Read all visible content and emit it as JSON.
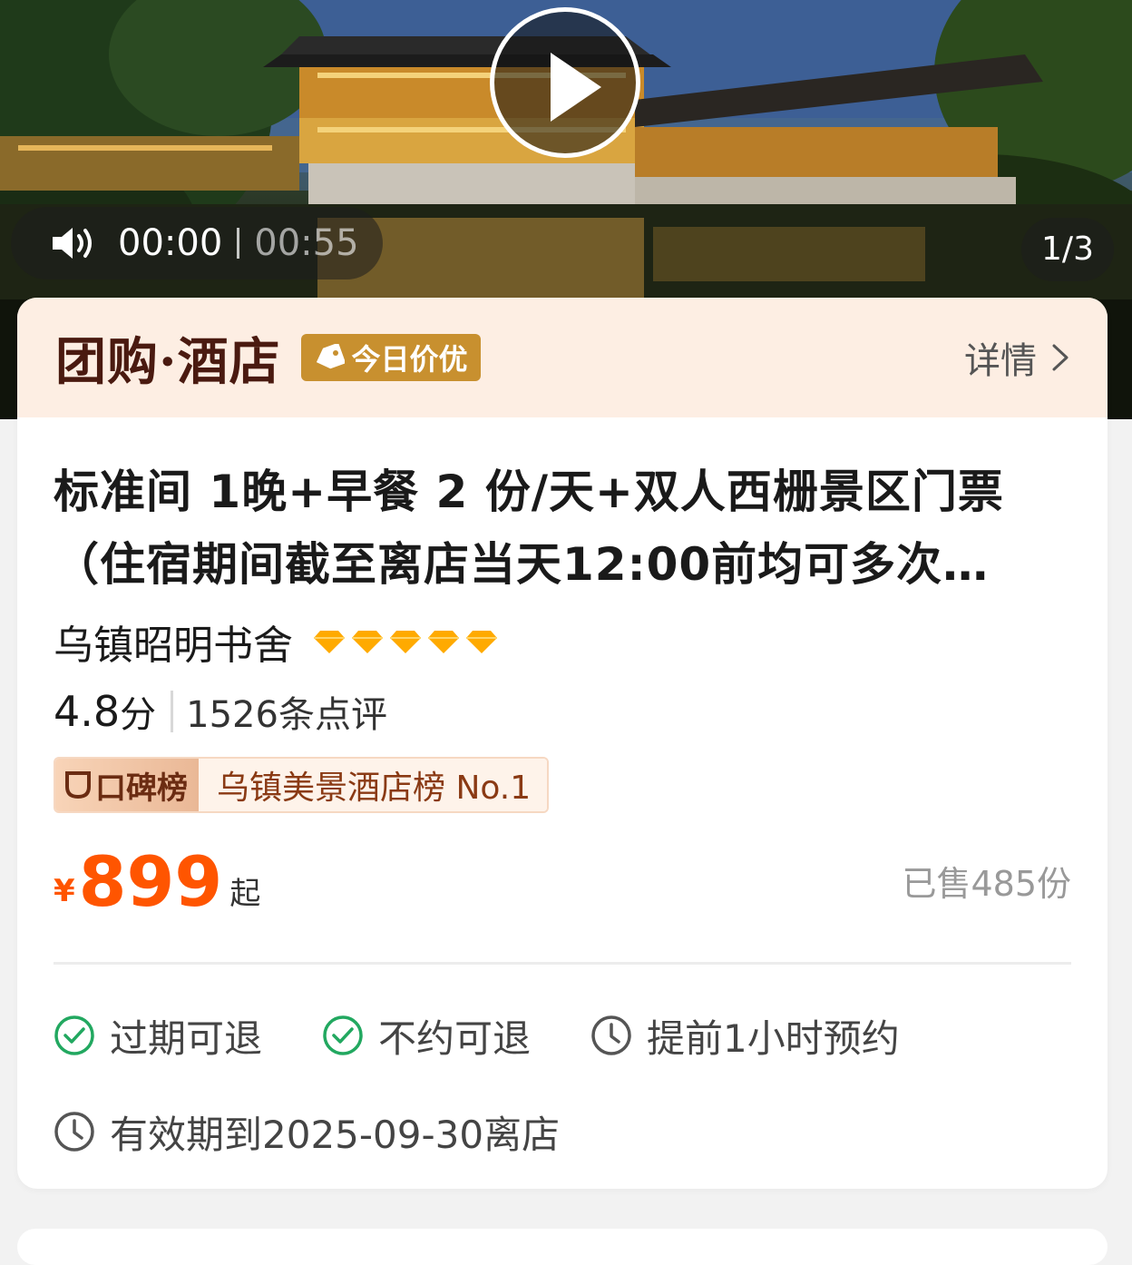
{
  "video": {
    "current_time": "00:00",
    "total_time": "00:55",
    "page_counter": "1/3"
  },
  "header": {
    "brand": "团购·酒店",
    "deal_badge": "今日价优",
    "details_label": "详情"
  },
  "product": {
    "title": "标准间 1晚+早餐 2 份/天+双人西栅景区门票（住宿期间截至离店当天12:00前均可多次…",
    "hotel_name": "乌镇昭明书舍",
    "diamond_count": 5,
    "score": "4.8",
    "score_unit": "分",
    "reviews": "1526条点评",
    "rank_badge": "口碑榜",
    "rank_text": "乌镇美景酒店榜 No.1",
    "currency": "¥",
    "price": "899",
    "price_suffix": "起",
    "sold": "已售485份"
  },
  "policies": [
    {
      "label": "过期可退",
      "icon": "check-circle-icon"
    },
    {
      "label": "不约可退",
      "icon": "check-circle-icon"
    },
    {
      "label": "提前1小时预约",
      "icon": "clock-icon"
    }
  ],
  "validity": {
    "label": "有效期到2025-09-30离店",
    "icon": "clock-icon"
  },
  "colors": {
    "accent_price": "#ff5500",
    "header_bg": "#fdeee3",
    "badge_gold": "#c8902f",
    "check_green": "#22a860",
    "diamond_orange": "#ffaa00"
  }
}
